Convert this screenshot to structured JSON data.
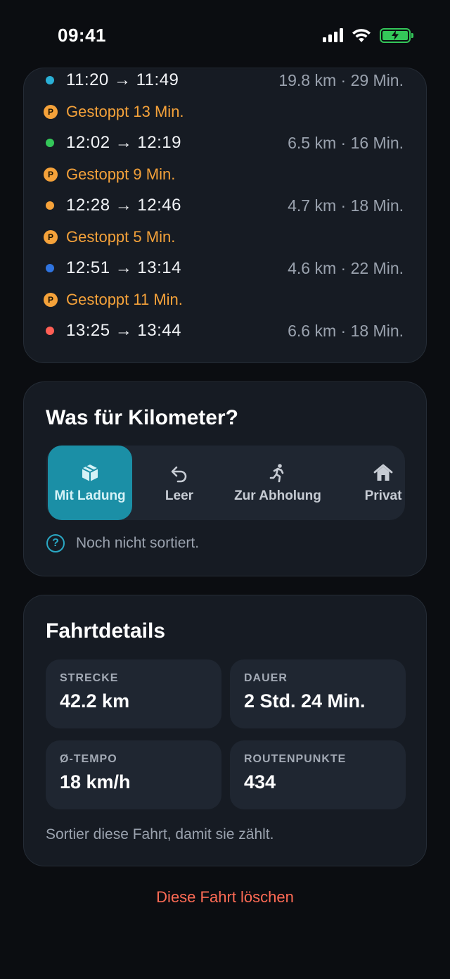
{
  "status_bar": {
    "time": "09:41"
  },
  "timeline": [
    {
      "type": "trip",
      "dot_color": "#2ab0d6",
      "times": "11:20 → 11:49",
      "meta": "19.8 km · 29 Min."
    },
    {
      "type": "stop",
      "badge": "P",
      "text": "Gestoppt 13 Min."
    },
    {
      "type": "trip",
      "dot_color": "#34c759",
      "times": "12:02 → 12:19",
      "meta": "6.5 km · 16 Min."
    },
    {
      "type": "stop",
      "badge": "P",
      "text": "Gestoppt 9 Min."
    },
    {
      "type": "trip",
      "dot_color": "#f5a23a",
      "times": "12:28 → 12:46",
      "meta": "4.7 km · 18 Min."
    },
    {
      "type": "stop",
      "badge": "P",
      "text": "Gestoppt 5 Min."
    },
    {
      "type": "trip",
      "dot_color": "#2f74e0",
      "times": "12:51 → 13:14",
      "meta": "4.6 km · 22 Min."
    },
    {
      "type": "stop",
      "badge": "P",
      "text": "Gestoppt 11 Min."
    },
    {
      "type": "trip",
      "dot_color": "#ff5f55",
      "times": "13:25 → 13:44",
      "meta": "6.6 km · 18 Min."
    }
  ],
  "km_card": {
    "title": "Was für Kilometer?",
    "options": [
      {
        "label": "Mit Ladung",
        "icon": "package-icon",
        "active": true
      },
      {
        "label": "Leer",
        "icon": "undo-arrow-icon",
        "active": false
      },
      {
        "label": "Zur Abholung",
        "icon": "running-person-icon",
        "active": false
      },
      {
        "label": "Privat",
        "icon": "house-icon",
        "active": false
      }
    ],
    "hint_icon": "?",
    "hint": "Noch nicht sortiert."
  },
  "details": {
    "title": "Fahrtdetails",
    "stats": [
      {
        "label": "STRECKE",
        "value": "42.2 km"
      },
      {
        "label": "DAUER",
        "value": "2 Std. 24 Min."
      },
      {
        "label": "Ø-TEMPO",
        "value": "18 km/h"
      },
      {
        "label": "ROUTENPUNKTE",
        "value": "434"
      }
    ],
    "note": "Sortier diese Fahrt, damit sie zählt."
  },
  "delete_label": "Diese Fahrt löschen",
  "colors": {
    "accent": "#1b8fa6",
    "stop": "#f5a23a",
    "danger": "#ff6b55",
    "battery": "#34c759"
  }
}
